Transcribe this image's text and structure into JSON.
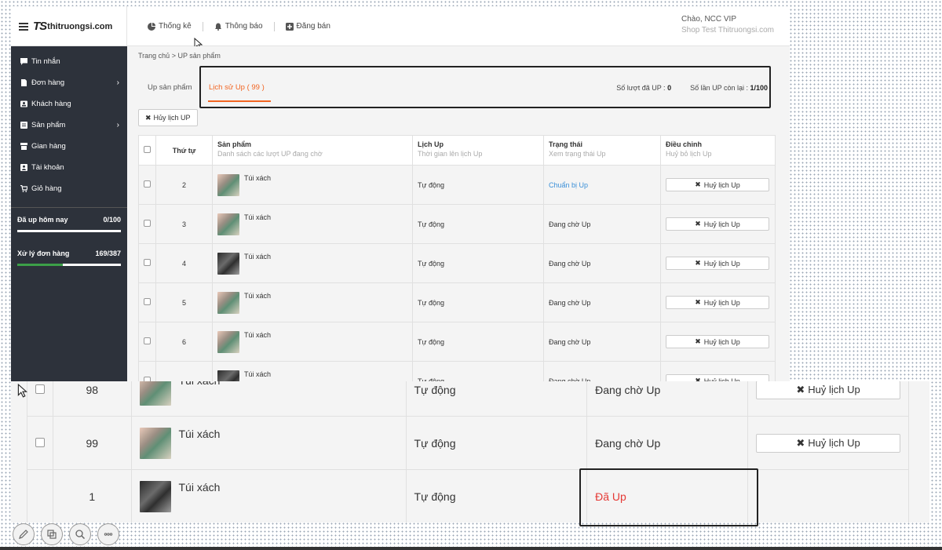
{
  "header": {
    "logo_mark": "TS",
    "logo_text": "thitruongsi.com",
    "nav": [
      {
        "label": "Thống kê",
        "icon": "pie-chart-icon"
      },
      {
        "label": "Thông báo",
        "icon": "bell-icon"
      },
      {
        "label": "Đăng bán",
        "icon": "plus-square-icon"
      }
    ],
    "greeting_prefix": "Chào, ",
    "user_name": "NCC VIP",
    "shop_name": "Shop Test Thitruongsi.com"
  },
  "sidebar": {
    "items": [
      {
        "label": "Tin nhắn",
        "icon": "message-icon",
        "has_sub": false
      },
      {
        "label": "Đơn hàng",
        "icon": "document-icon",
        "has_sub": true
      },
      {
        "label": "Khách hàng",
        "icon": "contact-icon",
        "has_sub": false
      },
      {
        "label": "Sản phẩm",
        "icon": "product-icon",
        "has_sub": true
      },
      {
        "label": "Gian hàng",
        "icon": "store-icon",
        "has_sub": false
      },
      {
        "label": "Tài khoản",
        "icon": "account-icon",
        "has_sub": false
      },
      {
        "label": "Giỏ hàng",
        "icon": "cart-icon",
        "has_sub": false
      }
    ],
    "stats": [
      {
        "label": "Đã up hôm nay",
        "value": "0/100",
        "progress": 0
      },
      {
        "label": "Xử lý đơn hàng",
        "value": "169/387",
        "progress": 0.437
      }
    ]
  },
  "breadcrumb": "Trang chủ > UP sản phẩm",
  "tabs": {
    "tab_up": "Up sản phẩm",
    "tab_history": "Lịch sử Up ( 99 )",
    "stat1_label": "Số lượt đã UP : ",
    "stat1_value": "0",
    "stat2_label": "Số lần UP còn lại : ",
    "stat2_value": "1/100"
  },
  "cancel_all_label": "Hủy lịch UP",
  "table": {
    "columns": [
      {
        "title": "Thứ tự",
        "sub": ""
      },
      {
        "title": "Sản phẩm",
        "sub": "Danh sách các lượt UP đang chờ"
      },
      {
        "title": "Lịch Up",
        "sub": "Thời gian lên lịch Up"
      },
      {
        "title": "Trạng thái",
        "sub": "Xem trạng thái Up"
      },
      {
        "title": "Điều chỉnh",
        "sub": "Huỷ bỏ lịch Up"
      }
    ],
    "rows": [
      {
        "order": "2",
        "product": "Túi xách",
        "thumb": "a",
        "schedule": "Tự động",
        "status": "Chuẩn bị Up",
        "status_style": "blue",
        "action": "Huỷ lịch Up"
      },
      {
        "order": "3",
        "product": "Túi xách",
        "thumb": "a",
        "schedule": "Tự động",
        "status": "Đang chờ Up",
        "status_style": "normal",
        "action": "Huỷ lịch Up"
      },
      {
        "order": "4",
        "product": "Túi xách",
        "thumb": "b",
        "schedule": "Tự động",
        "status": "Đang chờ Up",
        "status_style": "normal",
        "action": "Huỷ lịch Up"
      },
      {
        "order": "5",
        "product": "Túi xách",
        "thumb": "a",
        "schedule": "Tự động",
        "status": "Đang chờ Up",
        "status_style": "normal",
        "action": "Huỷ lịch Up"
      },
      {
        "order": "6",
        "product": "Túi xách",
        "thumb": "a",
        "schedule": "Tự động",
        "status": "Đang chờ Up",
        "status_style": "normal",
        "action": "Huỷ lịch Up"
      },
      {
        "order": "",
        "product": "Túi xách",
        "thumb": "b",
        "schedule": "Tự động",
        "status": "Đang chờ Up",
        "status_style": "normal",
        "action": "Huỷ lịch Up"
      }
    ]
  },
  "table_zoom": {
    "rows": [
      {
        "order": "98",
        "product": "Túi xách",
        "thumb": "a",
        "schedule": "Tự động",
        "status": "Đang chờ Up",
        "status_style": "normal",
        "action": "Huỷ lịch Up",
        "has_checkbox": true
      },
      {
        "order": "99",
        "product": "Túi xách",
        "thumb": "a",
        "schedule": "Tự động",
        "status": "Đang chờ Up",
        "status_style": "normal",
        "action": "Huỷ lịch Up",
        "has_checkbox": true
      },
      {
        "order": "1",
        "product": "Túi xách",
        "thumb": "b",
        "schedule": "Tự động",
        "status": "Đã Up",
        "status_style": "red",
        "action": "",
        "has_checkbox": false
      }
    ]
  },
  "colors": {
    "accent": "#f26522",
    "sidebar_bg": "#2d323b",
    "status_blue": "#3a8fd8",
    "status_red": "#e53935",
    "progress_green": "#3c9f48"
  }
}
